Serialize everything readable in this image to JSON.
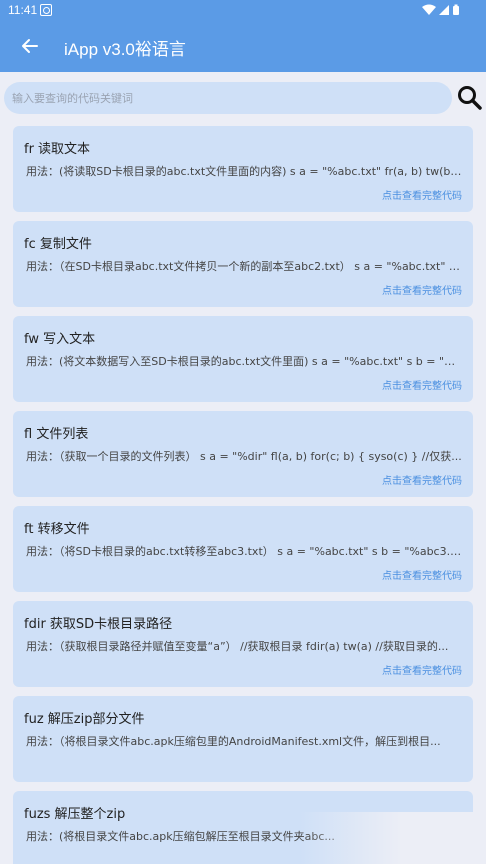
{
  "status_bar": {
    "time": "11:41"
  },
  "app_bar": {
    "title": "iApp v3.0裕语言"
  },
  "search": {
    "placeholder": "输入要查询的代码关键词"
  },
  "cards": [
    {
      "title": "fr 读取文本",
      "desc": "用法：(将读取SD卡根目录的abc.txt文件里面的内容) s a = \"%abc.txt\" fr(a, b) tw(b)  s...",
      "link": "点击查看完整代码"
    },
    {
      "title": "fc 复制文件",
      "desc": "用法：（在SD卡根目录abc.txt文件拷贝一个新的副本至abc2.txt） s a = \"%abc.txt\" s...",
      "link": "点击查看完整代码"
    },
    {
      "title": "fw 写入文本",
      "desc": "用法：(将文本数据写入至SD卡根目录的abc.txt文件里面) s a = \"%abc.txt\" s b = \"我是...",
      "link": "点击查看完整代码"
    },
    {
      "title": "fl 文件列表",
      "desc": "用法：（获取一个目录的文件列表） s a = \"%dir\" fl(a, b) for(c; b) {   syso(c) } //仅获...",
      "link": "点击查看完整代码"
    },
    {
      "title": "ft 转移文件",
      "desc": "用法：（将SD卡根目录的abc.txt转移至abc3.txt） s a = \"%abc.txt\" s b = \"%abc3.txt\"...",
      "link": "点击查看完整代码"
    },
    {
      "title": "fdir 获取SD卡根目录路径",
      "desc": "用法：（获取根目录路径并赋值至变量“a”） //获取根目录 fdir(a) tw(a)  //获取目录的...",
      "link": "点击查看完整代码"
    },
    {
      "title": "fuz 解压zip部分文件",
      "desc": "用法：（将根目录文件abc.apk压缩包里的AndroidManifest.xml文件，解压到根目...",
      "link": ""
    },
    {
      "title": "fuzs 解压整个zip",
      "desc": "用法：(将根目录文件abc.apk压缩包解压至根目录文件夹abc...",
      "link": ""
    }
  ]
}
